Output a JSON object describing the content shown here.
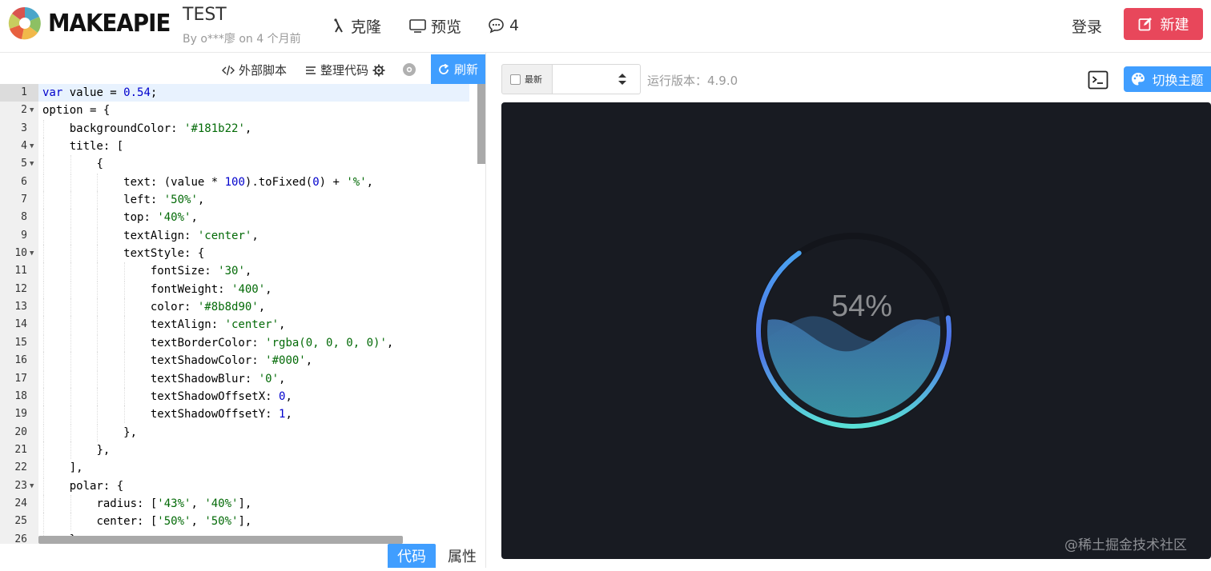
{
  "header": {
    "brand": "MAKEAPIE",
    "project_title": "TEST",
    "project_meta": "By o***廖 on 4 个月前",
    "nav": {
      "clone": "克隆",
      "preview": "预览",
      "comments": "4"
    },
    "login": "登录",
    "new": "新建"
  },
  "editor_toolbar": {
    "external_script": "外部脚本",
    "format_code": "整理代码",
    "refresh": "刷新"
  },
  "editor": {
    "lines": [
      {
        "n": "1",
        "fold": false,
        "indent": 0,
        "tokens": [
          [
            "kw",
            "var"
          ],
          [
            "p",
            " value = "
          ],
          [
            "num",
            "0.54"
          ],
          [
            "p",
            ";"
          ]
        ]
      },
      {
        "n": "2",
        "fold": true,
        "indent": 0,
        "tokens": [
          [
            "p",
            "option = {"
          ]
        ]
      },
      {
        "n": "3",
        "fold": false,
        "indent": 1,
        "tokens": [
          [
            "p",
            "backgroundColor: "
          ],
          [
            "str",
            "'#181b22'"
          ],
          [
            "p",
            ","
          ]
        ]
      },
      {
        "n": "4",
        "fold": true,
        "indent": 1,
        "tokens": [
          [
            "p",
            "title: ["
          ]
        ]
      },
      {
        "n": "5",
        "fold": true,
        "indent": 2,
        "tokens": [
          [
            "p",
            "{"
          ]
        ]
      },
      {
        "n": "6",
        "fold": false,
        "indent": 3,
        "tokens": [
          [
            "p",
            "text: (value * "
          ],
          [
            "num",
            "100"
          ],
          [
            "p",
            ").toFixed("
          ],
          [
            "num",
            "0"
          ],
          [
            "p",
            ") + "
          ],
          [
            "str",
            "'%'"
          ],
          [
            "p",
            ","
          ]
        ]
      },
      {
        "n": "7",
        "fold": false,
        "indent": 3,
        "tokens": [
          [
            "p",
            "left: "
          ],
          [
            "str",
            "'50%'"
          ],
          [
            "p",
            ","
          ]
        ]
      },
      {
        "n": "8",
        "fold": false,
        "indent": 3,
        "tokens": [
          [
            "p",
            "top: "
          ],
          [
            "str",
            "'40%'"
          ],
          [
            "p",
            ","
          ]
        ]
      },
      {
        "n": "9",
        "fold": false,
        "indent": 3,
        "tokens": [
          [
            "p",
            "textAlign: "
          ],
          [
            "str",
            "'center'"
          ],
          [
            "p",
            ","
          ]
        ]
      },
      {
        "n": "10",
        "fold": true,
        "indent": 3,
        "tokens": [
          [
            "p",
            "textStyle: {"
          ]
        ]
      },
      {
        "n": "11",
        "fold": false,
        "indent": 4,
        "tokens": [
          [
            "p",
            "fontSize: "
          ],
          [
            "str",
            "'30'"
          ],
          [
            "p",
            ","
          ]
        ]
      },
      {
        "n": "12",
        "fold": false,
        "indent": 4,
        "tokens": [
          [
            "p",
            "fontWeight: "
          ],
          [
            "str",
            "'400'"
          ],
          [
            "p",
            ","
          ]
        ]
      },
      {
        "n": "13",
        "fold": false,
        "indent": 4,
        "tokens": [
          [
            "p",
            "color: "
          ],
          [
            "str",
            "'#8b8d90'"
          ],
          [
            "p",
            ","
          ]
        ]
      },
      {
        "n": "14",
        "fold": false,
        "indent": 4,
        "tokens": [
          [
            "p",
            "textAlign: "
          ],
          [
            "str",
            "'center'"
          ],
          [
            "p",
            ","
          ]
        ]
      },
      {
        "n": "15",
        "fold": false,
        "indent": 4,
        "tokens": [
          [
            "p",
            "textBorderColor: "
          ],
          [
            "str",
            "'rgba(0, 0, 0, 0)'"
          ],
          [
            "p",
            ","
          ]
        ]
      },
      {
        "n": "16",
        "fold": false,
        "indent": 4,
        "tokens": [
          [
            "p",
            "textShadowColor: "
          ],
          [
            "str",
            "'#000'"
          ],
          [
            "p",
            ","
          ]
        ]
      },
      {
        "n": "17",
        "fold": false,
        "indent": 4,
        "tokens": [
          [
            "p",
            "textShadowBlur: "
          ],
          [
            "str",
            "'0'"
          ],
          [
            "p",
            ","
          ]
        ]
      },
      {
        "n": "18",
        "fold": false,
        "indent": 4,
        "tokens": [
          [
            "p",
            "textShadowOffsetX: "
          ],
          [
            "num",
            "0"
          ],
          [
            "p",
            ","
          ]
        ]
      },
      {
        "n": "19",
        "fold": false,
        "indent": 4,
        "tokens": [
          [
            "p",
            "textShadowOffsetY: "
          ],
          [
            "num",
            "1"
          ],
          [
            "p",
            ","
          ]
        ]
      },
      {
        "n": "20",
        "fold": false,
        "indent": 3,
        "tokens": [
          [
            "p",
            "},"
          ]
        ]
      },
      {
        "n": "21",
        "fold": false,
        "indent": 2,
        "tokens": [
          [
            "p",
            "},"
          ]
        ]
      },
      {
        "n": "22",
        "fold": false,
        "indent": 1,
        "tokens": [
          [
            "p",
            "],"
          ]
        ]
      },
      {
        "n": "23",
        "fold": true,
        "indent": 1,
        "tokens": [
          [
            "p",
            "polar: {"
          ]
        ]
      },
      {
        "n": "24",
        "fold": false,
        "indent": 2,
        "tokens": [
          [
            "p",
            "radius: ["
          ],
          [
            "str",
            "'43%'"
          ],
          [
            "p",
            ", "
          ],
          [
            "str",
            "'40%'"
          ],
          [
            "p",
            "],"
          ]
        ]
      },
      {
        "n": "25",
        "fold": false,
        "indent": 2,
        "tokens": [
          [
            "p",
            "center: ["
          ],
          [
            "str",
            "'50%'"
          ],
          [
            "p",
            ", "
          ],
          [
            "str",
            "'50%'"
          ],
          [
            "p",
            "],"
          ]
        ]
      },
      {
        "n": "26",
        "fold": false,
        "indent": 1,
        "tokens": [
          [
            "p",
            "},"
          ]
        ]
      }
    ]
  },
  "tabs": {
    "code": "代码",
    "props": "属性"
  },
  "preview_toolbar": {
    "latest": "最新",
    "version_value": "",
    "run_version": "运行版本：4.9.0",
    "switch_theme": "切换主题"
  },
  "chart": {
    "label": "54%",
    "value": 0.54,
    "background": "#181b22",
    "label_color": "#8b8d90",
    "watermark": "@稀土掘金技术社区"
  },
  "colors": {
    "accent": "#409eff",
    "new_button": "#e8475b"
  }
}
